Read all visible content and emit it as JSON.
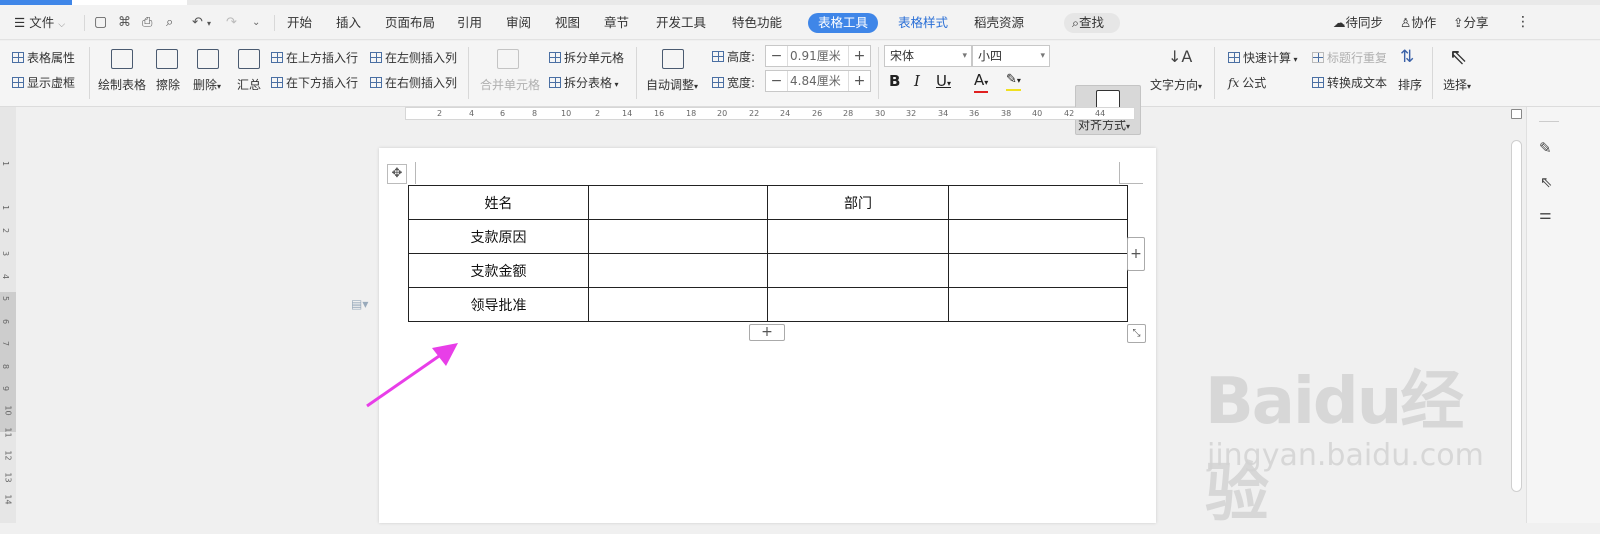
{
  "menu": {
    "file": "文件",
    "tabs": [
      "开始",
      "插入",
      "页面布局",
      "引用",
      "审阅",
      "视图",
      "章节",
      "开发工具",
      "特色功能"
    ],
    "active_tab": "表格工具",
    "tab_style": "表格样式",
    "tab_resources": "稻壳资源",
    "search": "查找",
    "sync": "待同步",
    "collab": "协作",
    "share": "分享"
  },
  "ribbon": {
    "table_props": "表格属性",
    "show_grid": "显示虚框",
    "draw_table": "绘制表格",
    "erase": "擦除",
    "delete": "删除",
    "summary": "汇总",
    "insert_above": "在上方插入行",
    "insert_below": "在下方插入行",
    "insert_left": "在左侧插入列",
    "insert_right": "在右侧插入列",
    "merge_cells": "合并单元格",
    "split_cells": "拆分单元格",
    "split_table": "拆分表格",
    "auto_fit": "自动调整",
    "height_label": "高度:",
    "height_value": "0.91厘米",
    "width_label": "宽度:",
    "width_value": "4.84厘米",
    "font_name": "宋体",
    "font_size": "小四",
    "bold": "B",
    "italic": "I",
    "underline": "U",
    "font_color": "A",
    "align": "对齐方式",
    "text_dir": "文字方向",
    "quick_calc": "快速计算",
    "formula": "公式",
    "repeat_header": "标题行重复",
    "to_text": "转换成文本",
    "sort": "排序",
    "select": "选择"
  },
  "ruler": [
    "2",
    "4",
    "6",
    "8",
    "10",
    "2",
    "14",
    "16",
    "18",
    "20",
    "22",
    "24",
    "26",
    "28",
    "30",
    "32",
    "34",
    "36",
    "38",
    "40",
    "42",
    "44"
  ],
  "vruler": [
    "1",
    "1",
    "2",
    "3",
    "4",
    "5",
    "6",
    "7",
    "8",
    "9",
    "10",
    "11",
    "12",
    "13",
    "14"
  ],
  "table": {
    "rows": [
      [
        "姓名",
        "",
        "部门",
        ""
      ],
      [
        "支款原因",
        "",
        "",
        ""
      ],
      [
        "支款金额",
        "",
        "",
        ""
      ],
      [
        "领导批准",
        "",
        "",
        ""
      ]
    ]
  },
  "watermark": {
    "brand": "Baidu经验",
    "url": "jingyan.baidu.com"
  },
  "colors": {
    "accent": "#3f86e8",
    "arrow": "#e83ee8"
  }
}
